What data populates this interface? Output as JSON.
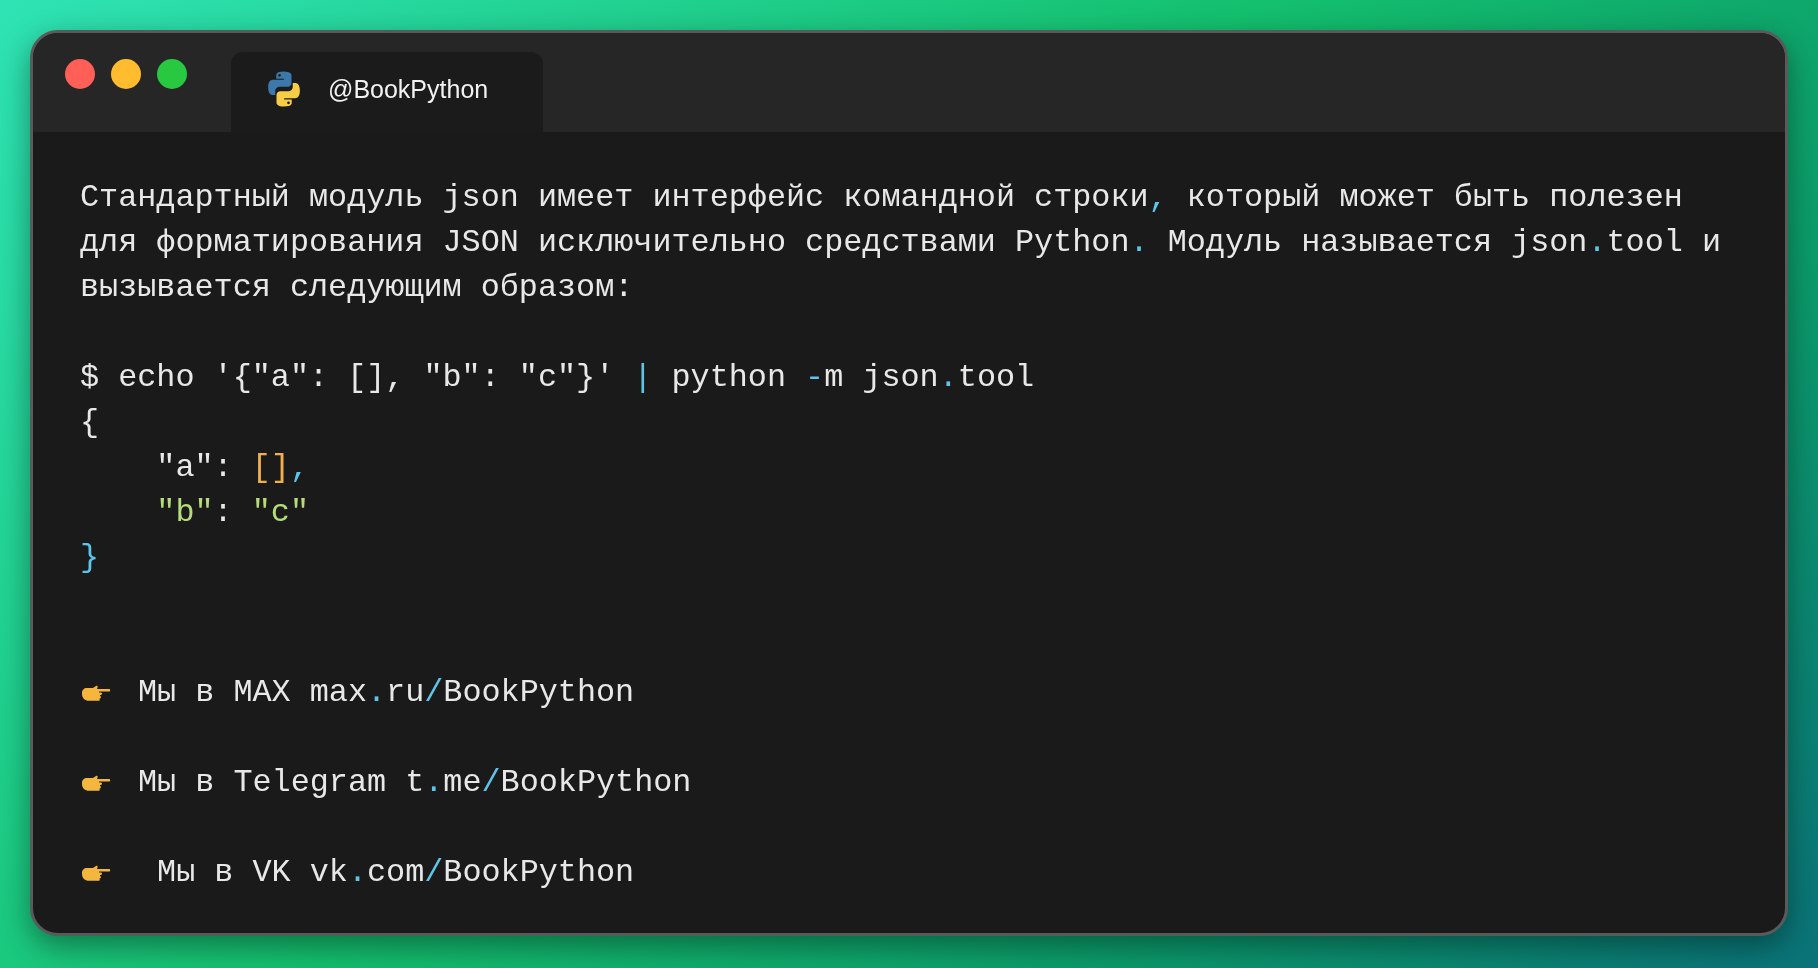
{
  "window": {
    "tab": {
      "label": "@BookPython",
      "selected": true
    }
  },
  "paragraph": [
    [
      {
        "text": "Стандартный модуль json имеет интерфейс командной строки",
        "kind": "text"
      },
      {
        "text": ",",
        "kind": "accent"
      },
      {
        "text": " который может быть полезен",
        "kind": "text"
      }
    ],
    [
      {
        "text": "для форматирования JSON исключительно средствами Python",
        "kind": "text"
      },
      {
        "text": ".",
        "kind": "accent"
      },
      {
        "text": " Модуль называется json",
        "kind": "text"
      },
      {
        "text": ".",
        "kind": "accent"
      },
      {
        "text": "tool и",
        "kind": "text"
      }
    ],
    [
      {
        "text": "вызывается следующим образом:",
        "kind": "text"
      }
    ]
  ],
  "code": [
    [
      {
        "text": "$ echo '{\"a\": [], \"b\": \"c\"}' ",
        "kind": "text"
      },
      {
        "text": "|",
        "kind": "accent"
      },
      {
        "text": " python ",
        "kind": "text"
      },
      {
        "text": "-",
        "kind": "accent"
      },
      {
        "text": "m json",
        "kind": "text"
      },
      {
        "text": ".",
        "kind": "accent"
      },
      {
        "text": "tool",
        "kind": "text"
      }
    ],
    [
      {
        "text": "{",
        "kind": "text"
      }
    ],
    [
      {
        "text": "    \"a\": ",
        "kind": "text"
      },
      {
        "text": "[]",
        "kind": "bracket"
      },
      {
        "text": ",",
        "kind": "accent"
      }
    ],
    [
      {
        "text": "    \"b\"",
        "kind": "string"
      },
      {
        "text": ": ",
        "kind": "text"
      },
      {
        "text": "\"c\"",
        "kind": "string"
      }
    ],
    [
      {
        "text": "}",
        "kind": "accent"
      }
    ]
  ],
  "links": [
    [
      {
        "text": "Мы в MAX max",
        "kind": "text"
      },
      {
        "text": ".",
        "kind": "accent"
      },
      {
        "text": "ru",
        "kind": "text"
      },
      {
        "text": "/",
        "kind": "accent"
      },
      {
        "text": "BookPython",
        "kind": "text"
      }
    ],
    [
      {
        "text": "Мы в Telegram t",
        "kind": "text"
      },
      {
        "text": ".",
        "kind": "accent"
      },
      {
        "text": "me",
        "kind": "text"
      },
      {
        "text": "/",
        "kind": "accent"
      },
      {
        "text": "BookPython",
        "kind": "text"
      }
    ],
    [
      {
        "text": " Мы в VK vk",
        "kind": "text"
      },
      {
        "text": ".",
        "kind": "accent"
      },
      {
        "text": "com",
        "kind": "text"
      },
      {
        "text": "/",
        "kind": "accent"
      },
      {
        "text": "BookPython",
        "kind": "text"
      }
    ]
  ]
}
